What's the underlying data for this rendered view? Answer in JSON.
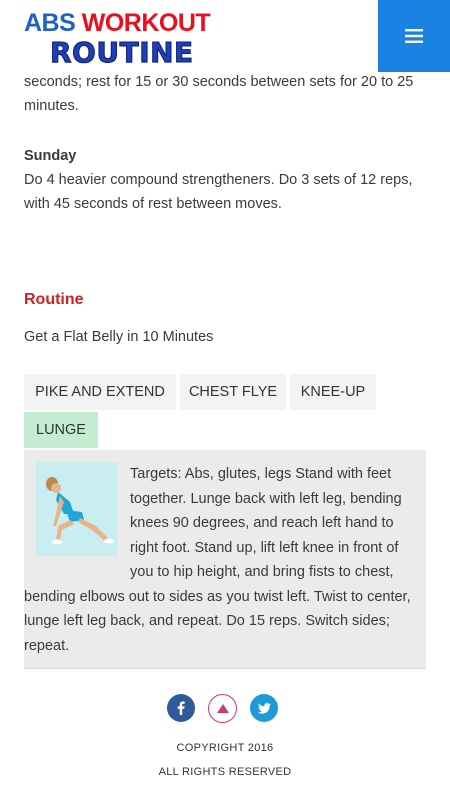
{
  "header": {
    "logo": {
      "line1_part1": "ABS",
      "line1_part2": "WORKOUT",
      "line2": "ROUTINE"
    },
    "menu_icon": "hamburger-menu-icon",
    "colors": {
      "menu_bg": "#1a82e2",
      "logo_blue": "#1e62c6",
      "logo_red": "#e8101e"
    }
  },
  "article": {
    "paragraph_top": "seconds; rest for 15 or 30 seconds between sets for 20 to 25 minutes.",
    "sunday": {
      "heading": "Sunday",
      "text": "Do 4 heavier compound strengtheners. Do 3 sets of 12 reps, with 45 seconds of rest between moves."
    }
  },
  "routine": {
    "heading": "Routine",
    "subtitle": "Get a Flat Belly in 10 Minutes",
    "heading_color": "#d21f1f",
    "tabs": [
      {
        "label": "PIKE AND EXTEND",
        "active": false
      },
      {
        "label": "CHEST FLYE",
        "active": false
      },
      {
        "label": "KNEE-UP",
        "active": false
      },
      {
        "label": "LUNGE",
        "active": true
      }
    ],
    "active_tab_color": "#c3ecd1",
    "panel": {
      "image": "woman-lunge-exercise-photo",
      "text": "Targets: Abs, glutes, legs Stand with feet together. Lunge back with left leg, bending knees 90 degrees, and reach left hand to right foot. Stand up, lift left knee in front of you to hip height, and bring fists to chest, bending elbows out to sides as you twist left. Twist to center, lunge left leg back, and repeat. Do 15 reps. Switch sides; repeat."
    }
  },
  "footer": {
    "social": [
      {
        "icon": "facebook-icon",
        "color": "#2f5a9c"
      },
      {
        "icon": "scroll-to-top-icon",
        "color": "#cc3b7e"
      },
      {
        "icon": "twitter-icon",
        "color": "#1f9ad9"
      }
    ],
    "copyright_line1": "COPYRIGHT 2016",
    "copyright_line2": "ALL RIGHTS RESERVED"
  }
}
